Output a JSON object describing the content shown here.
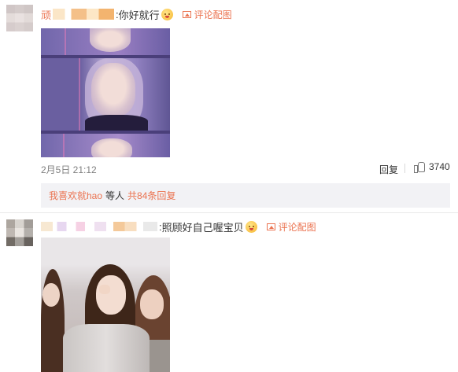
{
  "comments": [
    {
      "user_prefix": "顽",
      "text": "你好就行",
      "action_link": "评论配图",
      "date": "2月5日 21:12",
      "reply_label": "回复",
      "like_count": "3740",
      "sub_replies": {
        "user": "我喜欢就hao",
        "mid": "等人",
        "total": "共84条回复"
      }
    },
    {
      "text": "照顾好自己喔宝贝",
      "action_link": "评论配图"
    }
  ],
  "icons": {
    "picture": "picture-icon",
    "like": "thumbs-up-icon",
    "emoji": "emoji-icon"
  },
  "colors": {
    "accent": "#eb7350",
    "sub_bg": "#f2f2f5"
  }
}
